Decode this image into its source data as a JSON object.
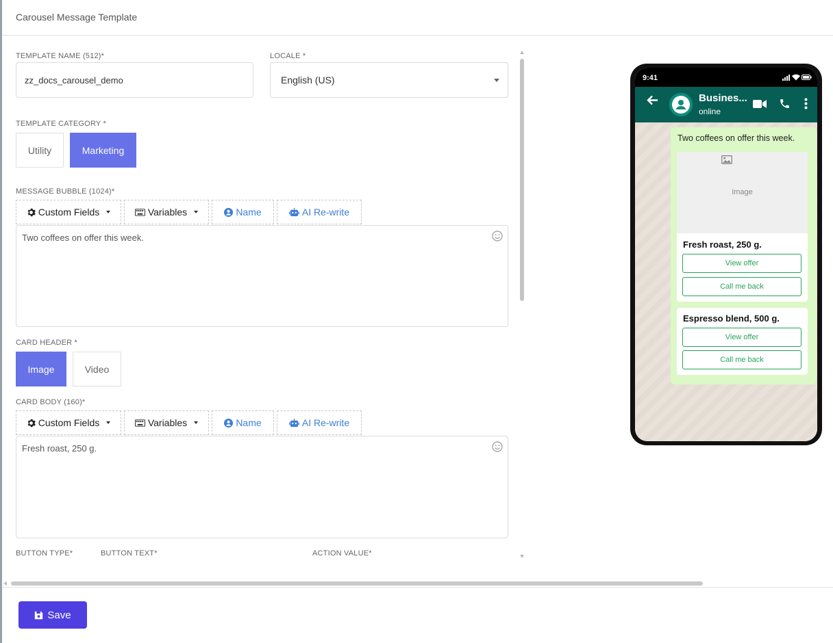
{
  "header": {
    "title": "Carousel Message Template"
  },
  "form": {
    "template_name": {
      "label": "TEMPLATE NAME (512)*",
      "value": "zz_docs_carousel_demo"
    },
    "locale": {
      "label": "LOCALE *",
      "value": "English (US)"
    },
    "category": {
      "label": "TEMPLATE CATEGORY *",
      "options": [
        "Utility",
        "Marketing"
      ],
      "selected": "Marketing"
    },
    "message_bubble": {
      "label": "MESSAGE BUBBLE (1024)*",
      "value": "Two coffees on offer this week."
    },
    "toolbar": {
      "custom_fields": "Custom Fields",
      "variables": "Variables",
      "name": "Name",
      "ai_rewrite": "AI Re-write"
    },
    "card_header": {
      "label": "CARD HEADER *",
      "options": [
        "Image",
        "Video"
      ],
      "selected": "Image"
    },
    "card_body": {
      "label": "CARD BODY (160)*",
      "value": "Fresh roast, 250 g."
    },
    "button_columns": {
      "type": "BUTTON TYPE*",
      "text": "BUTTON TEXT*",
      "action": "ACTION VALUE*"
    }
  },
  "footer": {
    "save_label": "Save"
  },
  "preview": {
    "time": "9:41",
    "business_name": "Busines...",
    "status": "online",
    "bubble_text": "Two coffees on offer this week.",
    "image_placeholder": "Image",
    "cards": [
      {
        "body": "Fresh roast, 250 g.",
        "buttons": [
          "View offer",
          "Call me back"
        ]
      },
      {
        "body": "Espresso blend, 500 g.",
        "buttons": [
          "View offer",
          "Call me back"
        ]
      }
    ]
  },
  "colors": {
    "accent": "#6771e8",
    "save": "#4f3fe0",
    "whatsapp_bar": "#075e54",
    "bubble": "#dcf8c6",
    "card_button": "#25a55a"
  }
}
